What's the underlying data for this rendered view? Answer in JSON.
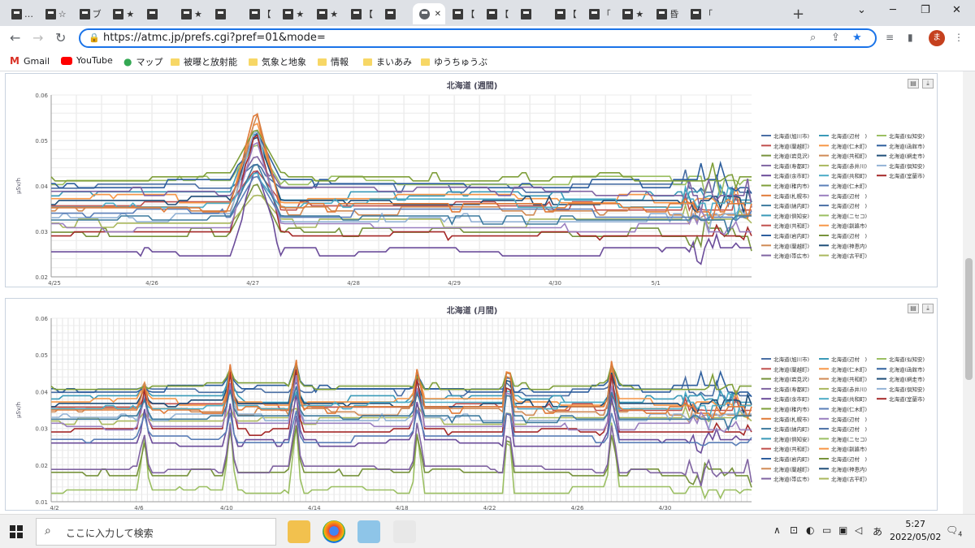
{
  "browser": {
    "tabs": [
      {
        "label": "…"
      },
      {
        "label": "☆"
      },
      {
        "label": "ブ"
      },
      {
        "label": "★"
      },
      {
        "label": ""
      },
      {
        "label": "★"
      },
      {
        "label": ""
      },
      {
        "label": "【"
      },
      {
        "label": "★"
      },
      {
        "label": "★"
      },
      {
        "label": "【"
      },
      {
        "label": ""
      },
      {
        "label": "",
        "active": true
      },
      {
        "label": "【"
      },
      {
        "label": "【"
      },
      {
        "label": ""
      },
      {
        "label": "【"
      },
      {
        "label": "「"
      },
      {
        "label": "★"
      },
      {
        "label": "昏"
      },
      {
        "label": "「"
      }
    ],
    "url": "https://atmc.jp/prefs.cgi?pref=01&mode=",
    "avatar_letter": "ま",
    "bookmarks": [
      "Gmail",
      "YouTube",
      "マップ",
      "被曝と放射能",
      "気象と地象",
      "情報",
      "まいあみ",
      "ゆうちゅうぶ"
    ]
  },
  "legend": [
    "北海道(旭川市)",
    "北海道(辺村　)",
    "北海道(似知安)",
    "北海道(蘭越町)",
    "北海道(仁木町)",
    "北海道(函館市)",
    "北海道(岩見沢)",
    "北海道(共和町)",
    "北海道(網走市)",
    "北海道(寿都町)",
    "北海道(赤井川)",
    "北海道(倶知安)",
    "北海道(余市町)",
    "北海道(共和町)",
    "北海道(室蘭市)",
    "北海道(稚内市)",
    "北海道(仁木町)",
    "北海道(札幌市)",
    "北海道(辺村　)",
    "北海道(納内町)",
    "北海道(辺村　)",
    "北海道(倶知安)",
    "北海道(ニセコ)",
    "北海道(共和町)",
    "北海道(釧路市)",
    "北海道(岩内町)",
    "北海道(辺村　)",
    "北海道(蘭越町)",
    "北海道(神恵内)",
    "北海道(帯広市)",
    "北海道(古平町)"
  ],
  "chart_data": [
    {
      "type": "line",
      "title": "北海道 (週間)",
      "ylabel": "μSv/h",
      "ylim": [
        0.02,
        0.06
      ],
      "yticks": [
        "0.02",
        "0.03",
        "0.04",
        "0.05",
        "0.06"
      ],
      "xticks": [
        "4/25",
        "4/26",
        "4/27",
        "4/28",
        "4/29",
        "4/30",
        "5/1"
      ],
      "x_range_days": [
        0,
        6.95
      ],
      "spikes": [
        {
          "at": 2.03,
          "height": 0.058
        }
      ],
      "series": [
        {
          "color": "#4a6fa5",
          "base": 0.0395
        },
        {
          "color": "#3a9ab8",
          "base": 0.0378
        },
        {
          "color": "#9bbf62",
          "base": 0.0412
        },
        {
          "color": "#c0504d",
          "base": 0.0356
        },
        {
          "color": "#f79646",
          "base": 0.0372
        },
        {
          "color": "#2e5f9e",
          "base": 0.0405
        },
        {
          "color": "#77933c",
          "base": 0.0298
        },
        {
          "color": "#d08a55",
          "base": 0.0345
        },
        {
          "color": "#1f4e79",
          "base": 0.0368
        },
        {
          "color": "#8064a2",
          "base": 0.0388
        },
        {
          "color": "#aab85e",
          "base": 0.0318
        },
        {
          "color": "#94b3d6",
          "base": 0.033
        },
        {
          "color": "#6b4c9a",
          "base": 0.0255
        },
        {
          "color": "#4bacc6",
          "base": 0.0362
        },
        {
          "color": "#a52a2a",
          "base": 0.029
        },
        {
          "color": "#7f9f3a",
          "base": 0.042
        },
        {
          "color": "#5b7fb8",
          "base": 0.034
        },
        {
          "color": "#e07b39",
          "base": 0.0352
        },
        {
          "color": "#9a7fc0",
          "base": 0.0308
        },
        {
          "color": "#3d7a9e",
          "base": 0.0325
        }
      ]
    },
    {
      "type": "line",
      "title": "北海道 (月間)",
      "ylabel": "μSv/h",
      "ylim": [
        0.01,
        0.06
      ],
      "yticks": [
        "0.01",
        "0.02",
        "0.03",
        "0.04",
        "0.05",
        "0.06"
      ],
      "xticks": [
        "4/2",
        "4/6",
        "4/10",
        "4/14",
        "4/18",
        "4/22",
        "4/26",
        "4/30"
      ],
      "x_range_days": [
        0,
        30.95
      ],
      "spikes": [
        {
          "at": 4.1,
          "height": 0.043
        },
        {
          "at": 7.9,
          "height": 0.048
        },
        {
          "at": 10.8,
          "height": 0.052
        },
        {
          "at": 16.2,
          "height": 0.048
        },
        {
          "at": 20.2,
          "height": 0.05
        },
        {
          "at": 24.8,
          "height": 0.051
        }
      ],
      "series": [
        {
          "color": "#4a6fa5",
          "base": 0.0398
        },
        {
          "color": "#3a9ab8",
          "base": 0.038
        },
        {
          "color": "#9bbf62",
          "base": 0.0132
        },
        {
          "color": "#c0504d",
          "base": 0.0358
        },
        {
          "color": "#f79646",
          "base": 0.0372
        },
        {
          "color": "#2e5f9e",
          "base": 0.0408
        },
        {
          "color": "#77933c",
          "base": 0.018
        },
        {
          "color": "#d08a55",
          "base": 0.0345
        },
        {
          "color": "#1f4e79",
          "base": 0.0368
        },
        {
          "color": "#8064a2",
          "base": 0.0188
        },
        {
          "color": "#aab85e",
          "base": 0.032
        },
        {
          "color": "#94b3d6",
          "base": 0.033
        },
        {
          "color": "#6b4c9a",
          "base": 0.026
        },
        {
          "color": "#4bacc6",
          "base": 0.0362
        },
        {
          "color": "#a52a2a",
          "base": 0.029
        },
        {
          "color": "#7f9f3a",
          "base": 0.0415
        },
        {
          "color": "#5b7fb8",
          "base": 0.027
        },
        {
          "color": "#e07b39",
          "base": 0.035
        },
        {
          "color": "#9a7fc0",
          "base": 0.0305
        },
        {
          "color": "#3d7a9e",
          "base": 0.0325
        }
      ]
    }
  ],
  "taskbar": {
    "search_placeholder": "ここに入力して検索",
    "time": "5:27",
    "date": "2022/05/02",
    "ime": "あ",
    "notifications": "4"
  },
  "colors": {
    "accent": "#1a73e8",
    "tabbar": "#dee1e6"
  }
}
